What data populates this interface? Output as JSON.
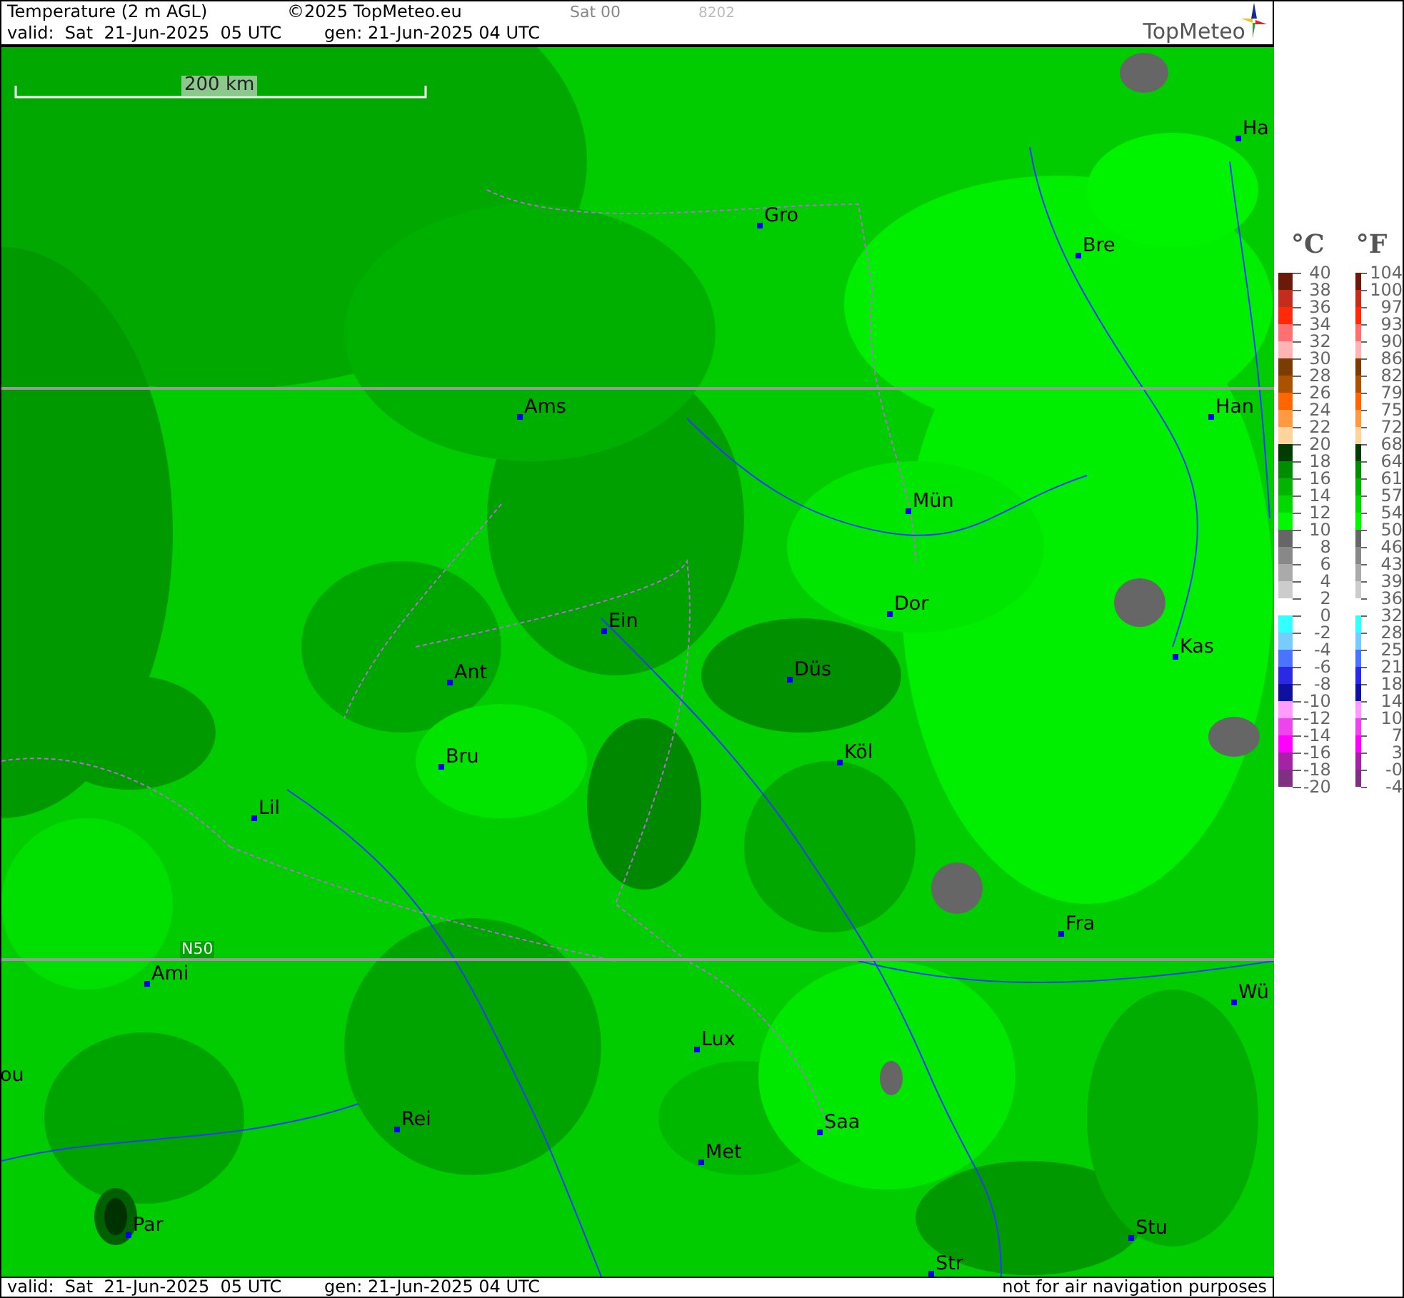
{
  "header": {
    "title": "Temperature (2 m AGL)",
    "copyright": "©2025 TopMeteo.eu",
    "run": "Sat 00",
    "code": "8202",
    "valid": "valid:  Sat  21-Jun-2025  05 UTC",
    "generated": "gen: 21-Jun-2025 04 UTC",
    "logo_text": "TopMeteo"
  },
  "map": {
    "scale_label": "200 km",
    "latitude_label": "N50",
    "cities": [
      {
        "name": "Ha"
      },
      {
        "name": "Gro"
      },
      {
        "name": "Bre"
      },
      {
        "name": "Ams"
      },
      {
        "name": "Han"
      },
      {
        "name": "Mün"
      },
      {
        "name": "Dor"
      },
      {
        "name": "Ein"
      },
      {
        "name": "Kas"
      },
      {
        "name": "Düs"
      },
      {
        "name": "Ant"
      },
      {
        "name": "Köl"
      },
      {
        "name": "Bru"
      },
      {
        "name": "Lil"
      },
      {
        "name": "Fra"
      },
      {
        "name": "Ami"
      },
      {
        "name": "Wü"
      },
      {
        "name": "Lux"
      },
      {
        "name": "ou"
      },
      {
        "name": "Rei"
      },
      {
        "name": "Saa"
      },
      {
        "name": "Met"
      },
      {
        "name": "Par"
      },
      {
        "name": "Stu"
      },
      {
        "name": "Str"
      }
    ]
  },
  "legend": {
    "celsius_header": "°C",
    "fahrenheit_header": "°F",
    "steps": [
      {
        "c": "40",
        "f": "104",
        "color": "#6b1a0a"
      },
      {
        "c": "38",
        "f": "100",
        "color": "#c42c1c"
      },
      {
        "c": "36",
        "f": "97",
        "color": "#ff2a0a"
      },
      {
        "c": "34",
        "f": "93",
        "color": "#ff7070"
      },
      {
        "c": "32",
        "f": "90",
        "color": "#ffb4b4"
      },
      {
        "c": "30",
        "f": "86",
        "color": "#7a3c00"
      },
      {
        "c": "28",
        "f": "82",
        "color": "#aa5200"
      },
      {
        "c": "26",
        "f": "79",
        "color": "#ff6600"
      },
      {
        "c": "24",
        "f": "75",
        "color": "#ff9a40"
      },
      {
        "c": "22",
        "f": "72",
        "color": "#ffd49a"
      },
      {
        "c": "20",
        "f": "68",
        "color": "#003c00"
      },
      {
        "c": "18",
        "f": "64",
        "color": "#008c00"
      },
      {
        "c": "16",
        "f": "61",
        "color": "#00b400"
      },
      {
        "c": "14",
        "f": "57",
        "color": "#00d800"
      },
      {
        "c": "12",
        "f": "54",
        "color": "#00f800"
      },
      {
        "c": "10",
        "f": "50",
        "color": "#666666"
      },
      {
        "c": "8",
        "f": "46",
        "color": "#888888"
      },
      {
        "c": "6",
        "f": "43",
        "color": "#aaaaaa"
      },
      {
        "c": "4",
        "f": "39",
        "color": "#cccccc"
      },
      {
        "c": "2",
        "f": "36"
      },
      {
        "c": "0",
        "f": "32",
        "color": "#33ffff"
      },
      {
        "c": "-2",
        "f": "28",
        "color": "#77ccff"
      },
      {
        "c": "-4",
        "f": "25",
        "color": "#4a74ff"
      },
      {
        "c": "-6",
        "f": "21",
        "color": "#2a2ae6"
      },
      {
        "c": "-8",
        "f": "18",
        "color": "#1010a0"
      },
      {
        "c": "-10",
        "f": "14",
        "color": "#ff9cff"
      },
      {
        "c": "-12",
        "f": "10",
        "color": "#ee44ee"
      },
      {
        "c": "-14",
        "f": "7",
        "color": "#ff00ff"
      },
      {
        "c": "-16",
        "f": "3",
        "color": "#a422a4"
      },
      {
        "c": "-18",
        "f": "-0",
        "color": "#803080"
      },
      {
        "c": "-20",
        "f": "-4"
      }
    ]
  },
  "footer": {
    "valid": "valid:  Sat  21-Jun-2025  05 UTC",
    "generated": "gen: 21-Jun-2025 04 UTC",
    "disclaimer": "not for air navigation purposes"
  }
}
